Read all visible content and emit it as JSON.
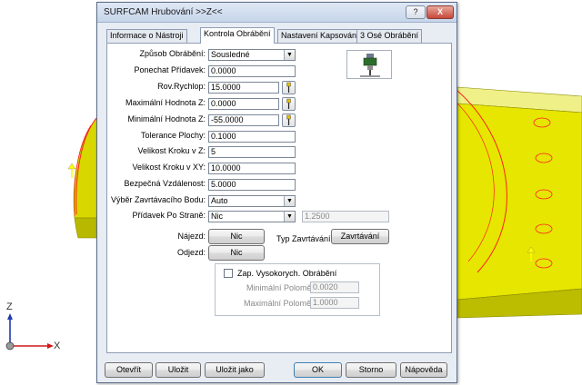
{
  "window": {
    "title": "SURFCAM Hrubování >>Z<<",
    "help_glyph": "?",
    "close_glyph": "X"
  },
  "tabs": [
    {
      "label": "Informace o Nástroji"
    },
    {
      "label": "Kontrola Obrábění"
    },
    {
      "label": "Nastavení Kapsování"
    },
    {
      "label": "3 Osé Obrábění"
    }
  ],
  "form": {
    "zpusob": {
      "label": "Způsob Obrábění:",
      "value": "Sousledné"
    },
    "ponechat": {
      "label": "Ponechat Přídavek:",
      "value": "0.0000"
    },
    "rov_rychlop": {
      "label": "Rov.Rychlop:",
      "value": "15.0000"
    },
    "max_z": {
      "label": "Maximální Hodnota Z:",
      "value": "0.0000"
    },
    "min_z": {
      "label": "Minimální Hodnota Z:",
      "value": "-55.0000"
    },
    "tolerance": {
      "label": "Tolerance Plochy:",
      "value": "0.1000"
    },
    "krok_z": {
      "label": "Velikost Kroku v Z:",
      "value": "5"
    },
    "krok_xy": {
      "label": "Velikost Kroku v XY:",
      "value": "10.0000"
    },
    "bezpecna": {
      "label": "Bezpečná Vzdálenost:",
      "value": "5.0000"
    },
    "vyber": {
      "label": "Výběr Zavrtávacího Bodu:",
      "value": "Auto"
    },
    "pridavek_strane": {
      "label": "Přídavek Po Straně:",
      "value": "Nic",
      "extra_value": "1.2500"
    },
    "najezd": {
      "label": "Nájezd:",
      "button": "Nic"
    },
    "typ_zavrtavani": {
      "label": "Typ Zavrtávání:",
      "button": "Zavrtávání"
    },
    "odjezd": {
      "label": "Odjezd:",
      "button": "Nic"
    }
  },
  "hsm": {
    "checkbox_label": "Zap. Vysokorych. Obrábění",
    "checked": false,
    "min_polomer": {
      "label": "Minimální Poloměr:",
      "value": "0.0020"
    },
    "max_polomer": {
      "label": "Maximální Poloměr:",
      "value": "1.0000"
    }
  },
  "buttons": {
    "otevrit": "Otevřít",
    "ulozit": "Uložit",
    "ulozit_jako": "Uložit jako",
    "ok": "OK",
    "storno": "Storno",
    "napoveda": "Nápověda"
  },
  "axes": {
    "z_label": "Z",
    "x_label": "X"
  },
  "colors": {
    "part_yellow": "#e6e600",
    "toolpath_red": "#ff2020",
    "axis_blue": "#1e3aa8",
    "axis_red": "#d01818"
  },
  "icons": {
    "pick_button": "pick-point-icon",
    "tool_preview": "tool-holder-icon"
  }
}
